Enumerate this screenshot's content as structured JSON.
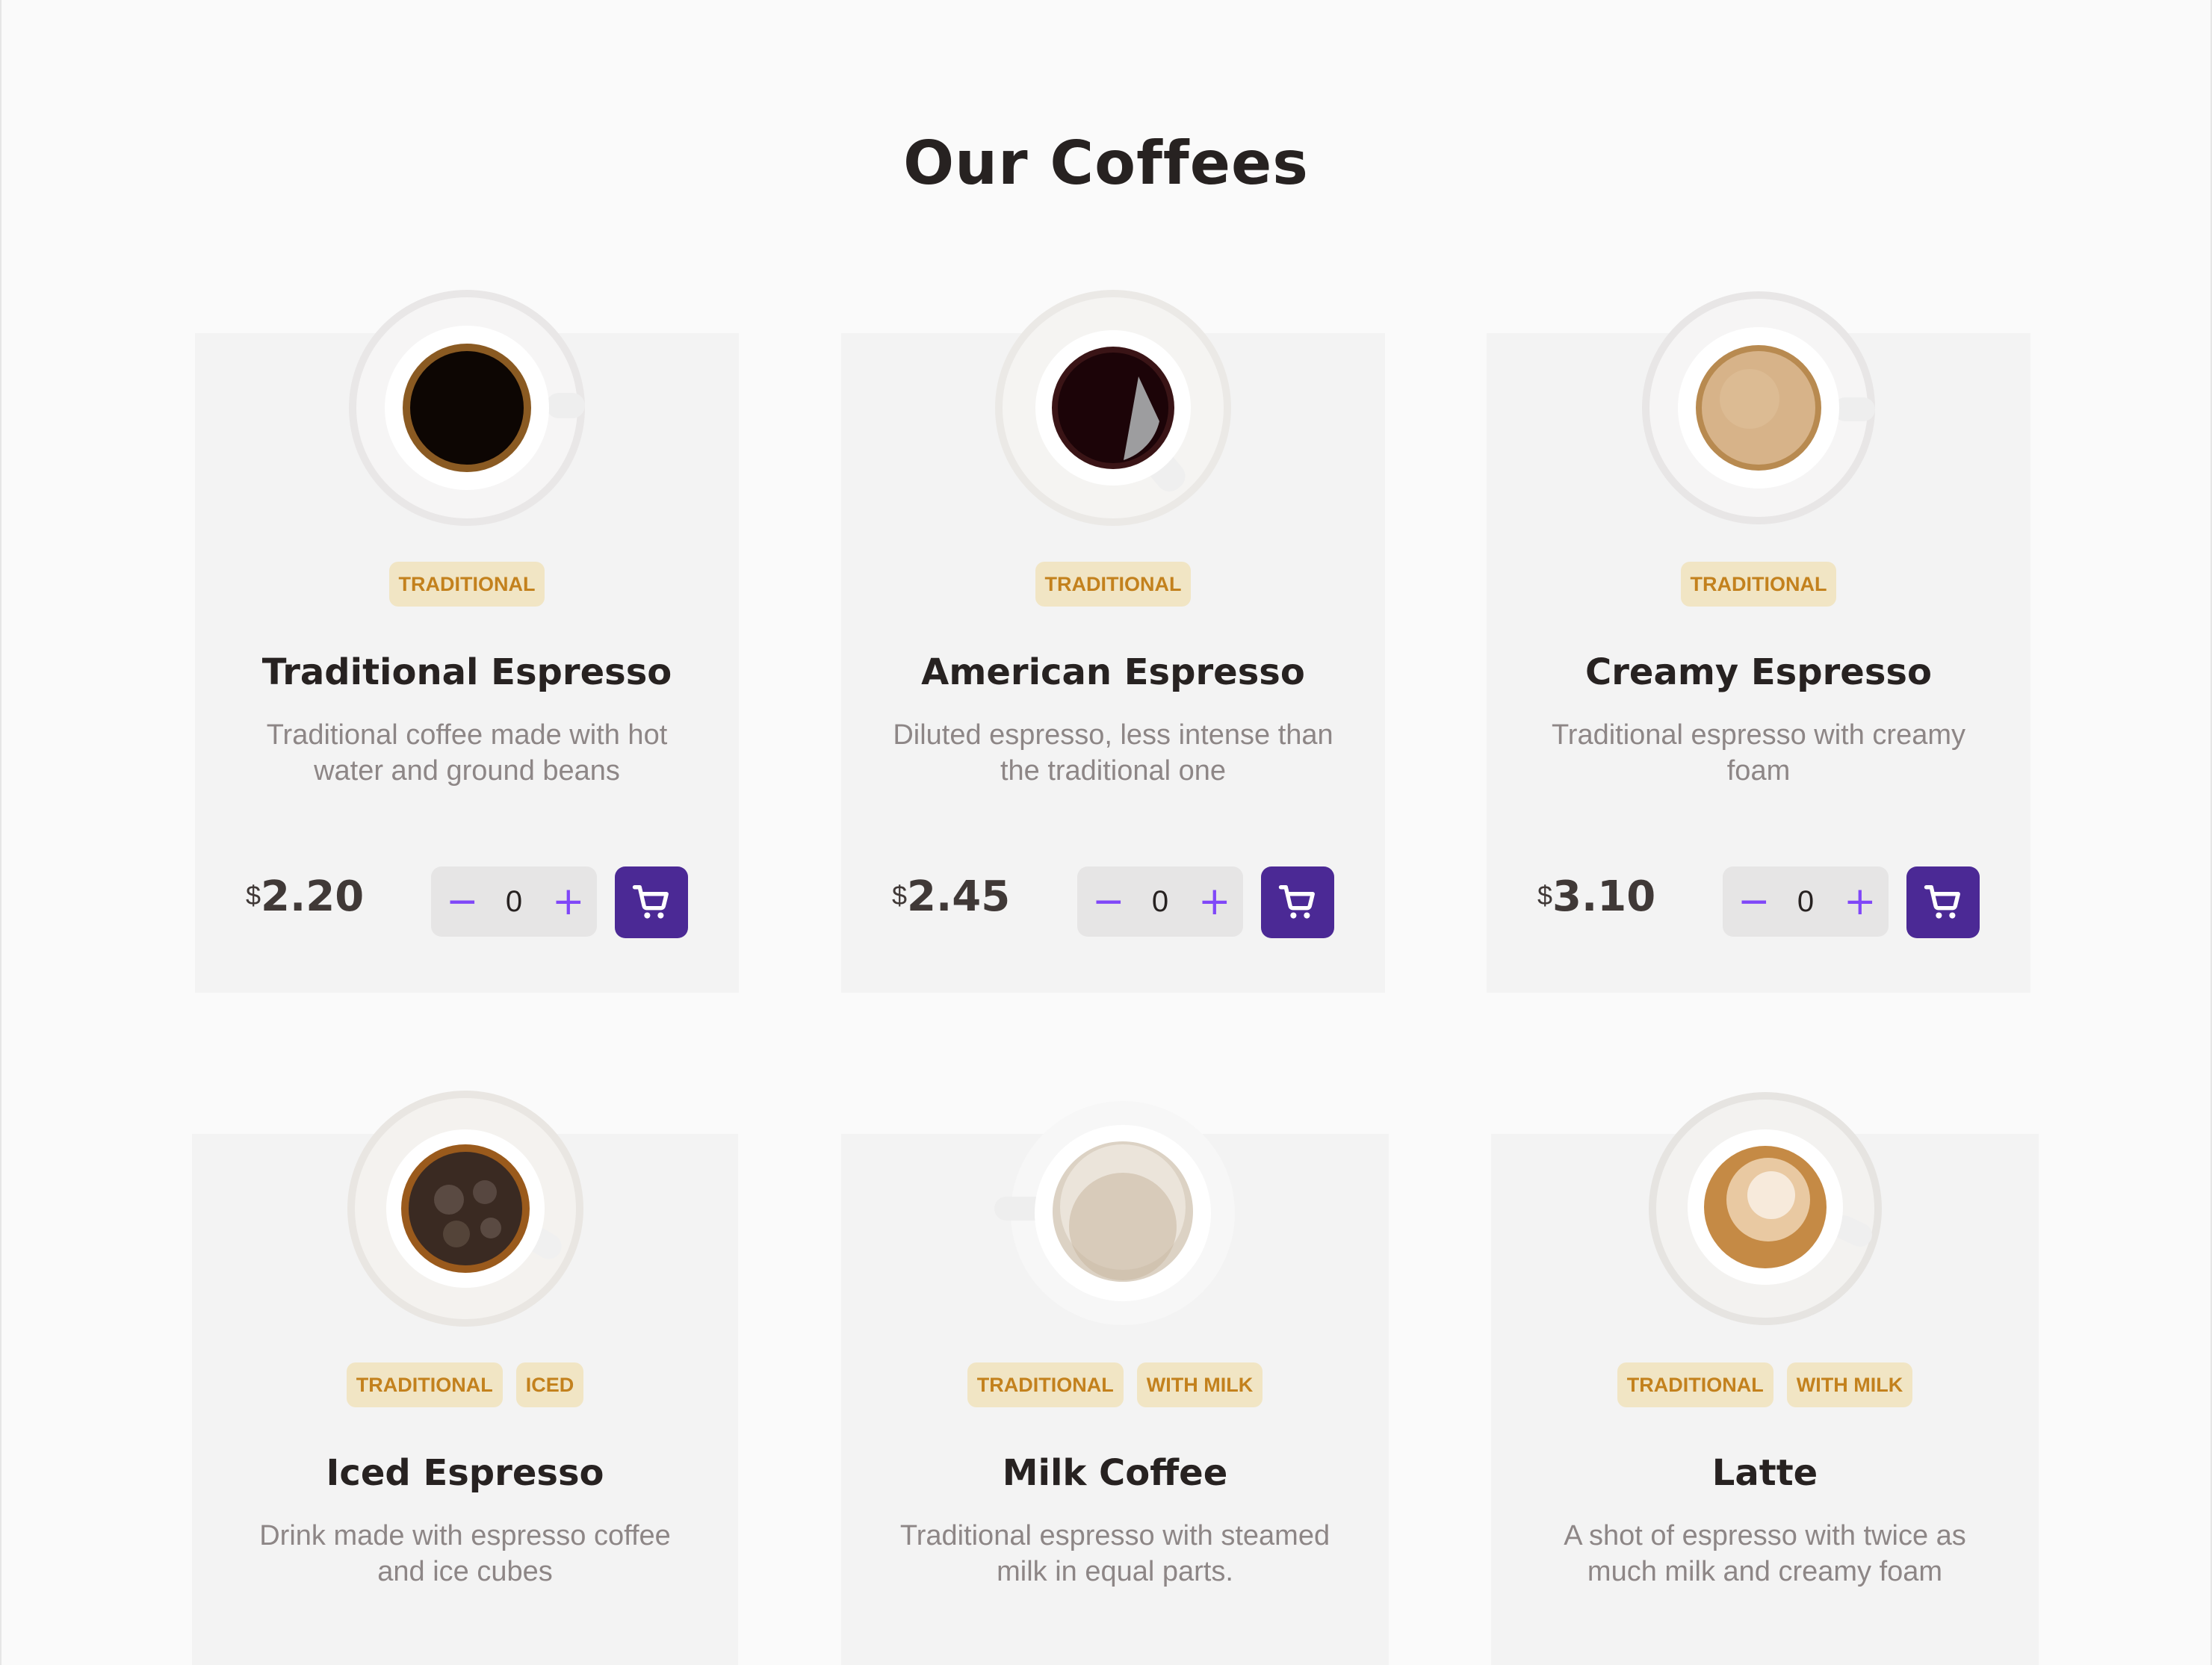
{
  "section": {
    "title": "Our Coffees"
  },
  "currency_symbol": "$",
  "colors": {
    "background": "#fafafa",
    "card": "#f3f3f3",
    "tag_bg": "#f1e5c4",
    "tag_text": "#c3811d",
    "accent_purple": "#8047f8",
    "cart_button": "#4b2995",
    "title_text": "#272221",
    "description_text": "#8d8686"
  },
  "products": [
    {
      "name": "Traditional Espresso",
      "description": "Traditional coffee made with hot water and ground beans",
      "tags": [
        "TRADITIONAL"
      ],
      "price": "2.20",
      "quantity": "0",
      "cup_icon": "espresso-cup-icon"
    },
    {
      "name": "American Espresso",
      "description": "Diluted espresso, less intense than the traditional one",
      "tags": [
        "TRADITIONAL"
      ],
      "price": "2.45",
      "quantity": "0",
      "cup_icon": "americano-cup-icon"
    },
    {
      "name": "Creamy Espresso",
      "description": "Traditional espresso with creamy foam",
      "tags": [
        "TRADITIONAL"
      ],
      "price": "3.10",
      "quantity": "0",
      "cup_icon": "creamy-espresso-cup-icon"
    },
    {
      "name": "Iced Espresso",
      "description": "Drink made with espresso coffee and ice cubes",
      "tags": [
        "TRADITIONAL",
        "ICED"
      ],
      "cup_icon": "iced-espresso-cup-icon"
    },
    {
      "name": "Milk Coffee",
      "description": "Traditional espresso with steamed milk in equal parts.",
      "tags": [
        "TRADITIONAL",
        "WITH MILK"
      ],
      "cup_icon": "milk-coffee-cup-icon"
    },
    {
      "name": "Latte",
      "description": "A shot of espresso with twice as much milk and creamy foam",
      "tags": [
        "TRADITIONAL",
        "WITH MILK"
      ],
      "cup_icon": "latte-cup-icon"
    }
  ],
  "stepper": {
    "minus": "−",
    "plus": "+"
  }
}
